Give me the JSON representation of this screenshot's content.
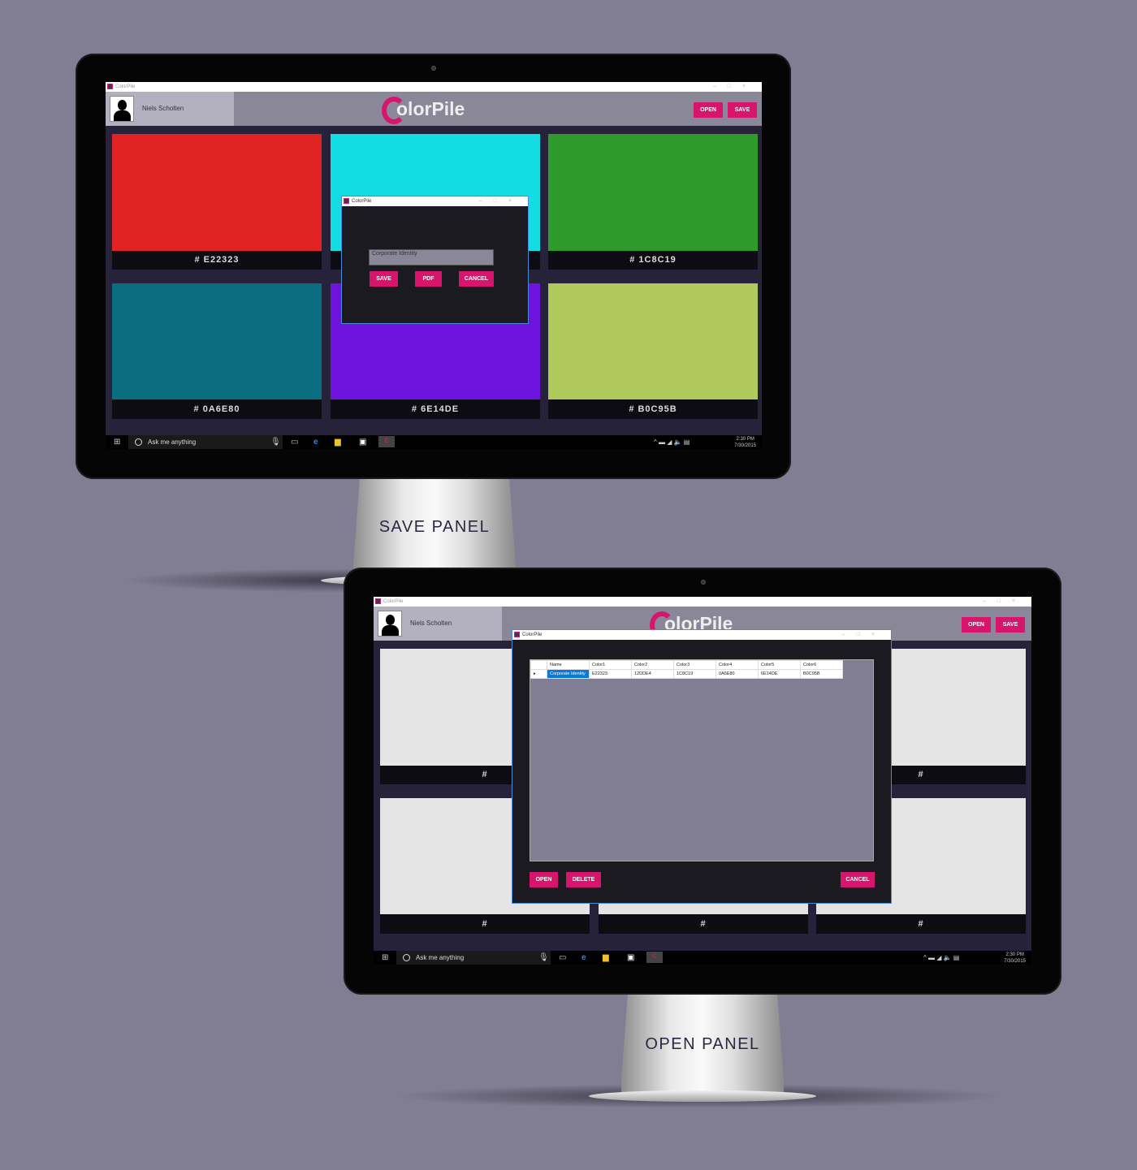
{
  "app": {
    "title": "ColorPile",
    "user": "Niels Scholten",
    "logo": "olorPile",
    "open": "OPEN",
    "save": "SAVE"
  },
  "save_panel": {
    "label": "SAVE PANEL",
    "swatches": [
      {
        "hex": "# E22323",
        "color": "#e22323"
      },
      {
        "hex": "",
        "color": "#12dde4"
      },
      {
        "hex": "# 1C8C19",
        "color": "#2f9a2c"
      },
      {
        "hex": "# 0A6E80",
        "color": "#0a6e80"
      },
      {
        "hex": "# 6E14DE",
        "color": "#6e14de"
      },
      {
        "hex": "# B0C95B",
        "color": "#b0c95b"
      }
    ],
    "dialog": {
      "title": "ColorPile",
      "name_value": "Corporate Identity",
      "save": "SAVE",
      "pdf": "PDF",
      "cancel": "CANCEL"
    }
  },
  "open_panel": {
    "label": "OPEN PANEL",
    "swatch_label": "#",
    "dialog": {
      "title": "ColorPile",
      "columns": [
        "Name",
        "Color1",
        "Color2",
        "Color3",
        "Color4",
        "Color5",
        "Color6"
      ],
      "rows": [
        [
          "Corporate Identity",
          "E22323",
          "12DDE4",
          "1C8C19",
          "0A6E80",
          "6E14DE",
          "B0C95B"
        ]
      ],
      "open": "OPEN",
      "delete": "DELETE",
      "cancel": "CANCEL"
    }
  },
  "taskbar": {
    "search": "Ask me anything",
    "time": "2:30 PM",
    "date": "7/30/2015"
  },
  "colors": {
    "accent": "#d8156c",
    "header": "#8a8799",
    "background": "#817e93"
  }
}
